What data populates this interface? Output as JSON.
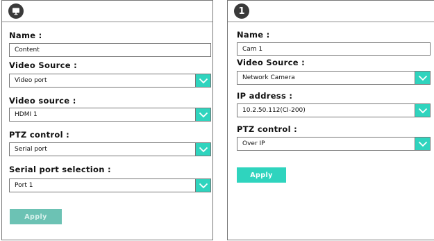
{
  "left_panel": {
    "badge_icon": "monitor-icon",
    "name_label": "Name :",
    "name_value": "Content",
    "video_source_label": "Video Source :",
    "video_source_value": "Video port",
    "video_source2_label": "Video source :",
    "video_source2_value": "HDMI 1",
    "ptz_label": "PTZ control :",
    "ptz_value": "Serial port",
    "serial_label": "Serial port selection :",
    "serial_value": "Port 1",
    "apply_label": "Apply",
    "apply_color": "#6cc2b4"
  },
  "right_panel": {
    "badge_number": "1",
    "name_label": "Name :",
    "name_value": "Cam 1",
    "video_source_label": "Video Source :",
    "video_source_value": "Network Camera",
    "ip_label": "IP address :",
    "ip_value": "10.2.50.112(CI-200)",
    "ptz_label": "PTZ control :",
    "ptz_value": "Over IP",
    "apply_label": "Apply",
    "apply_color": "#2fd4be"
  },
  "colors": {
    "accent": "#2fd4be",
    "badge_bg": "#3a3a3a"
  }
}
